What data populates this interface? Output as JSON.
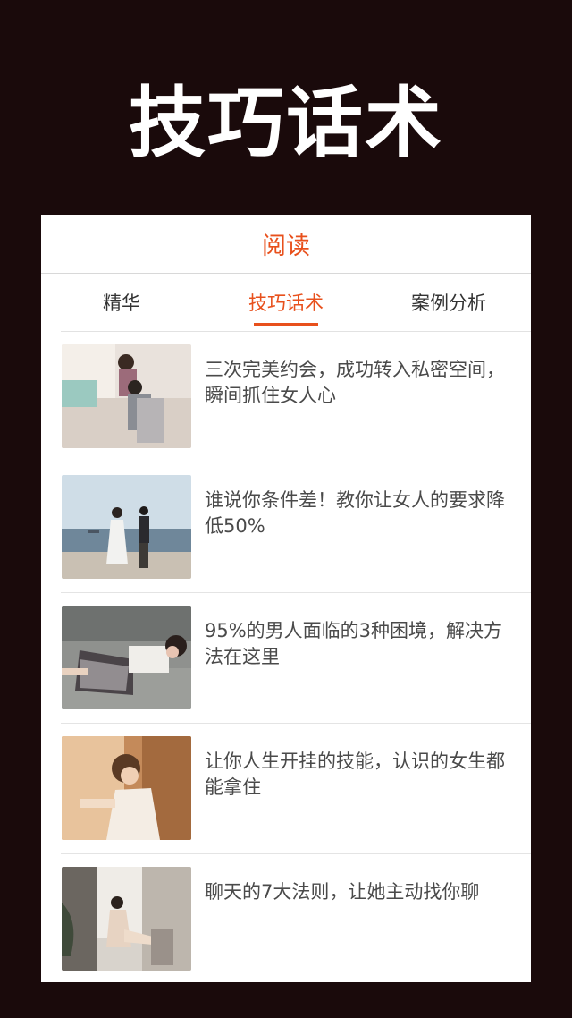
{
  "hero": {
    "title": "技巧话术"
  },
  "nav": {
    "title": "阅读"
  },
  "tabs": [
    {
      "label": "精华"
    },
    {
      "label": "技巧话术"
    },
    {
      "label": "案例分析"
    }
  ],
  "active_tab": "技巧话术",
  "articles": [
    {
      "title": "三次完美约会，成功转入私密空间，瞬间抓住女人心"
    },
    {
      "title": "谁说你条件差！教你让女人的要求降低50%"
    },
    {
      "title": "95%的男人面临的3种困境，解决方法在这里"
    },
    {
      "title": "让你人生开挂的技能，认识的女生都能拿住"
    },
    {
      "title": "聊天的7大法则，让她主动找你聊"
    }
  ],
  "colors": {
    "background": "#1a0a0b",
    "accent": "#e8501c",
    "card": "#ffffff",
    "text": "#4a4a4a"
  }
}
